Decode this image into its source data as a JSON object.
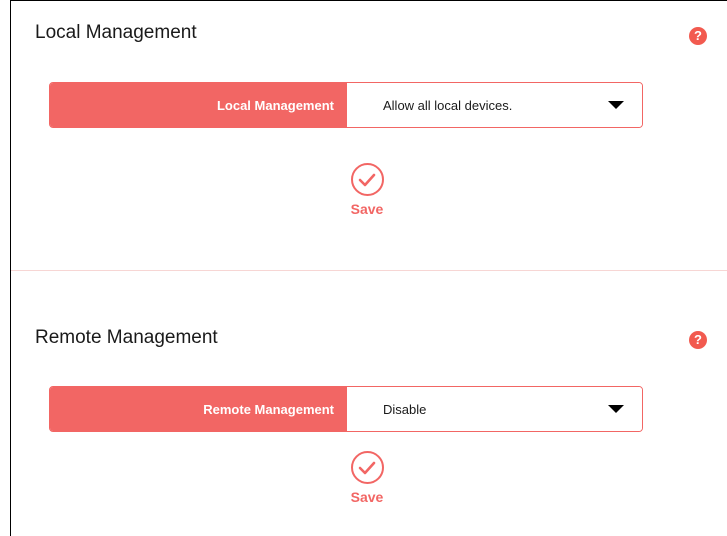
{
  "local": {
    "title": "Local Management",
    "help": "?",
    "field_label": "Local Management",
    "select_value": "Allow all local devices.",
    "save_label": "Save"
  },
  "remote": {
    "title": "Remote Management",
    "help": "?",
    "field_label": "Remote Management",
    "select_value": "Disable",
    "save_label": "Save"
  },
  "colors": {
    "accent": "#f26664",
    "help_icon": "#f25a4f",
    "divider": "#f7d6d4"
  },
  "icons": {
    "help": "help-icon",
    "save": "checkmark-icon",
    "dropdown": "caret-down-icon"
  }
}
